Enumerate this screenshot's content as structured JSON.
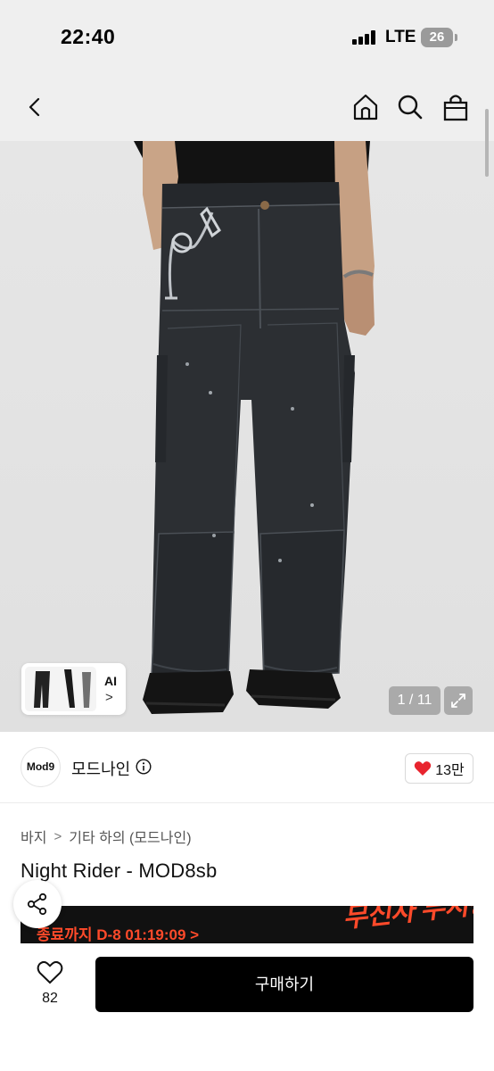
{
  "status_bar": {
    "time": "22:40",
    "network": "LTE",
    "battery": "26"
  },
  "nav": {
    "back_icon": "chevron-left-icon",
    "home_icon": "home-icon",
    "search_icon": "search-icon",
    "cart_icon": "shopping-bag-icon"
  },
  "gallery": {
    "ai_label": "AI",
    "ai_chevron": ">",
    "counter": "1 / 11",
    "expand_icon": "expand-icon"
  },
  "brand": {
    "logo_text": "Mod9",
    "name": "모드나인",
    "like_count": "13만"
  },
  "breadcrumb": {
    "category": "바지",
    "subcategory": "기타 하의 (모드나인)",
    "separator": ">"
  },
  "product": {
    "title": "Night Rider - MOD8sb"
  },
  "promo": {
    "countdown": "종료까지 D-8 01:19:09 >",
    "art_text": "무신사 무지장"
  },
  "bottom_bar": {
    "wish_count": "82",
    "buy_label": "구매하기"
  },
  "colors": {
    "header_bg": "#efefef",
    "promo_accent": "#ff4a2a",
    "heart": "#e8242e",
    "buy_button": "#000000"
  }
}
